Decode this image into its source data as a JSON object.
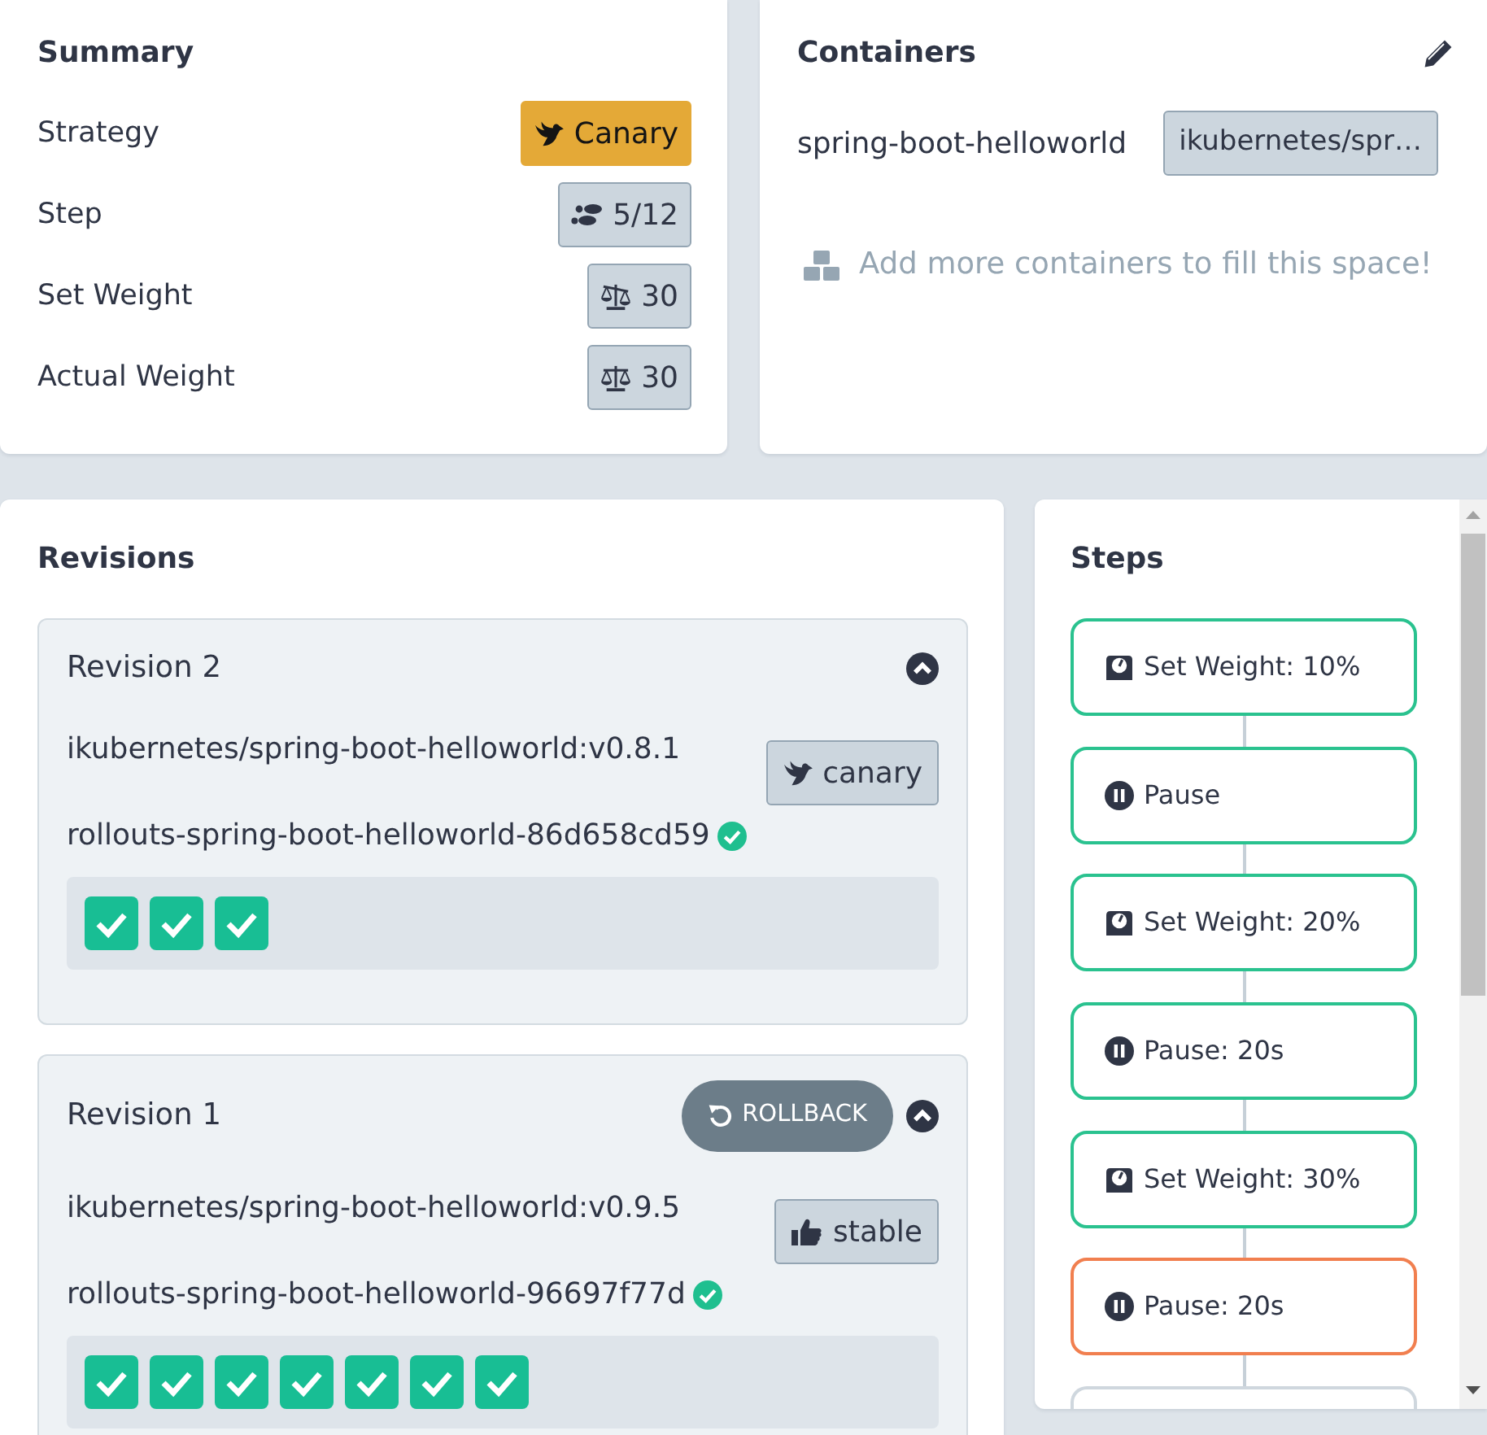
{
  "summary": {
    "title": "Summary",
    "rows": [
      {
        "kind": "strategy",
        "label": "Strategy",
        "value": "Canary"
      },
      {
        "kind": "step",
        "label": "Step",
        "value": "5/12"
      },
      {
        "kind": "set_weight",
        "label": "Set Weight",
        "value": "30"
      },
      {
        "kind": "actual_weight",
        "label": "Actual Weight",
        "value": "30"
      }
    ]
  },
  "containers": {
    "title": "Containers",
    "items": [
      {
        "name": "spring-boot-helloworld",
        "image": "ikubernetes/spr…"
      }
    ],
    "hint": "Add more containers to fill this space!"
  },
  "revisions": {
    "title": "Revisions",
    "items": [
      {
        "title": "Revision 2",
        "expanded": true,
        "image": "ikubernetes/spring-boot-helloworld:v0.8.1",
        "badge": {
          "kind": "canary",
          "label": "canary"
        },
        "replicaset": {
          "name": "rollouts-spring-boot-helloworld-86d658cd59",
          "healthy": true
        },
        "pods": [
          {
            "ready": true
          },
          {
            "ready": true
          },
          {
            "ready": true
          }
        ]
      },
      {
        "title": "Revision 1",
        "rollback": "ROLLBACK",
        "expanded": true,
        "image": "ikubernetes/spring-boot-helloworld:v0.9.5",
        "badge": {
          "kind": "stable",
          "label": "stable"
        },
        "replicaset": {
          "name": "rollouts-spring-boot-helloworld-96697f77d",
          "healthy": true
        },
        "pods": [
          {
            "ready": true
          },
          {
            "ready": true
          },
          {
            "ready": true
          },
          {
            "ready": true
          },
          {
            "ready": true
          },
          {
            "ready": true
          },
          {
            "ready": true
          }
        ]
      }
    ]
  },
  "steps": {
    "title": "Steps",
    "items": [
      {
        "kind": "set_weight",
        "label": "Set Weight: 10%",
        "complete": true,
        "current": false
      },
      {
        "kind": "pause",
        "label": "Pause",
        "complete": true,
        "current": false
      },
      {
        "kind": "set_weight",
        "label": "Set Weight: 20%",
        "complete": true,
        "current": false
      },
      {
        "kind": "pause",
        "label": "Pause: 20s",
        "complete": true,
        "current": false
      },
      {
        "kind": "set_weight",
        "label": "Set Weight: 30%",
        "complete": true,
        "current": false
      },
      {
        "kind": "pause",
        "label": "Pause: 20s",
        "complete": false,
        "current": true
      },
      {
        "complete": false,
        "current": false
      }
    ]
  }
}
